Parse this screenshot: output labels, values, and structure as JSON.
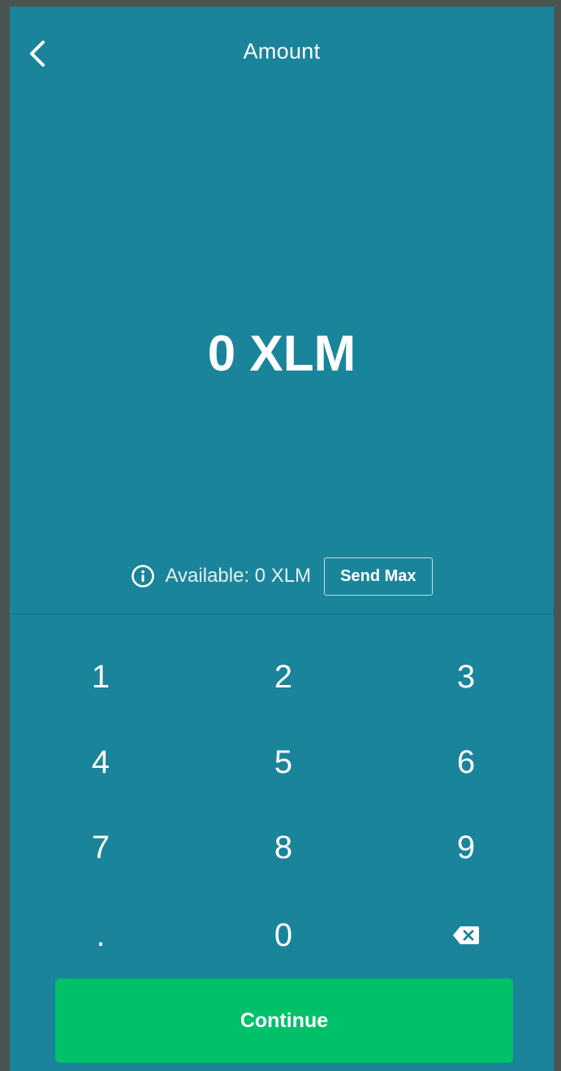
{
  "header": {
    "title": "Amount",
    "back_icon": "chevron-left-icon"
  },
  "amount": {
    "display": "0 XLM"
  },
  "balance": {
    "available_label": "Available: 0 XLM",
    "info_icon": "info-icon",
    "send_max_label": "Send Max"
  },
  "keypad": {
    "rows": [
      [
        "1",
        "2",
        "3"
      ],
      [
        "4",
        "5",
        "6"
      ],
      [
        "7",
        "8",
        "9"
      ],
      [
        ".",
        "0"
      ]
    ],
    "backspace_icon": "backspace-icon"
  },
  "continue_label": "Continue",
  "colors": {
    "background": "#1a849b",
    "frame": "#4a5450",
    "continue": "#00c06a",
    "text": "#ffffff"
  }
}
